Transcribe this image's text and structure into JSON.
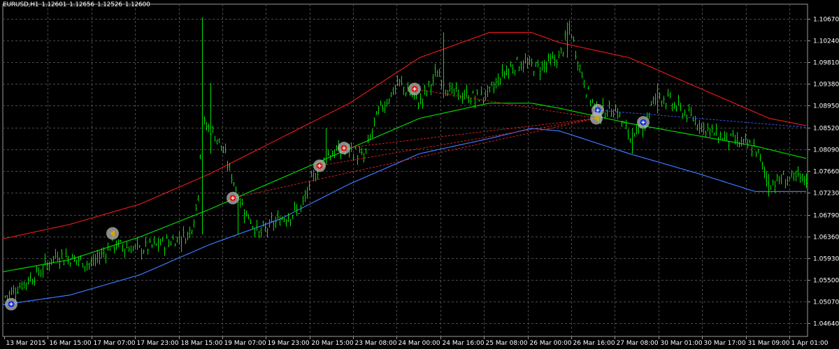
{
  "window": {
    "symbol_timeframe": "EURUSD,H1",
    "ohlc": [
      "1.12601",
      "1.12656",
      "1.12526",
      "1.12600"
    ]
  },
  "colors": {
    "background": "#000000",
    "grid": "#4a4a4a",
    "candles": "#00e000",
    "upper_band": "#e01818",
    "middle_band": "#00d800",
    "lower_band": "#3c78ff",
    "dotted_line": "#cc2020",
    "dotted_blue": "#3050e0",
    "axis_text": "#ffffff"
  },
  "chart_data": {
    "type": "candlestick",
    "ylim": [
      1.0438,
      1.1096
    ],
    "y_ticks": [
      "1.10670",
      "1.10240",
      "1.09810",
      "1.09380",
      "1.08950",
      "1.08520",
      "1.08090",
      "1.07660",
      "1.07230",
      "1.06790",
      "1.06360",
      "1.05930",
      "1.05500",
      "1.05070",
      "1.04640"
    ],
    "x_ticks": [
      "13 Mar 2015",
      "16 Mar 15:00",
      "17 Mar 07:00",
      "17 Mar 23:00",
      "18 Mar 15:00",
      "19 Mar 07:00",
      "19 Mar 23:00",
      "20 Mar 15:00",
      "23 Mar 08:00",
      "24 Mar 00:00",
      "24 Mar 16:00",
      "25 Mar 08:00",
      "26 Mar 00:00",
      "26 Mar 16:00",
      "27 Mar 08:00",
      "30 Mar 01:00",
      "30 Mar 17:00",
      "31 Mar 09:00",
      "1 Apr 01:00"
    ],
    "price_anchors": [
      [
        0,
        1.051
      ],
      [
        30,
        1.054
      ],
      [
        60,
        1.057
      ],
      [
        80,
        1.06
      ],
      [
        110,
        1.059
      ],
      [
        130,
        1.058
      ],
      [
        160,
        1.062
      ],
      [
        200,
        1.061
      ],
      [
        240,
        1.0625
      ],
      [
        270,
        1.064
      ],
      [
        282,
        1.07
      ],
      [
        288,
        1.086
      ],
      [
        300,
        1.085
      ],
      [
        315,
        1.082
      ],
      [
        330,
        1.076
      ],
      [
        345,
        1.07
      ],
      [
        370,
        1.064
      ],
      [
        400,
        1.067
      ],
      [
        430,
        1.069
      ],
      [
        450,
        1.076
      ],
      [
        470,
        1.08
      ],
      [
        500,
        1.081
      ],
      [
        520,
        1.079
      ],
      [
        540,
        1.088
      ],
      [
        570,
        1.094
      ],
      [
        600,
        1.09
      ],
      [
        625,
        1.096
      ],
      [
        645,
        1.092
      ],
      [
        680,
        1.091
      ],
      [
        700,
        1.092
      ],
      [
        720,
        1.096
      ],
      [
        740,
        1.098
      ],
      [
        770,
        1.097
      ],
      [
        800,
        1.099
      ],
      [
        815,
        1.105
      ],
      [
        825,
        1.099
      ],
      [
        840,
        1.092
      ],
      [
        855,
        1.088
      ],
      [
        880,
        1.089
      ],
      [
        905,
        1.082
      ],
      [
        920,
        1.086
      ],
      [
        940,
        1.092
      ],
      [
        960,
        1.09
      ],
      [
        990,
        1.087
      ],
      [
        1020,
        1.084
      ],
      [
        1060,
        1.082
      ],
      [
        1080,
        1.081
      ],
      [
        1100,
        1.074
      ],
      [
        1120,
        1.075
      ],
      [
        1155,
        1.075
      ]
    ],
    "spikes": [
      {
        "at": 288,
        "high": 1.107,
        "low": 1.064
      },
      {
        "at": 300,
        "high": 1.094,
        "low": 1.08
      },
      {
        "at": 340,
        "high": 1.072,
        "low": 1.064
      },
      {
        "at": 465,
        "high": 1.085,
        "low": 1.078
      },
      {
        "at": 635,
        "high": 1.104,
        "low": 1.091
      },
      {
        "at": 812,
        "high": 1.106,
        "low": 1.099
      },
      {
        "at": 905,
        "high": 1.085,
        "low": 1.08
      },
      {
        "at": 940,
        "high": 1.094,
        "low": 1.088
      },
      {
        "at": 1100,
        "high": 1.076,
        "low": 1.0715
      }
    ],
    "series": [
      {
        "key": "upper",
        "anchors": [
          [
            0,
            1.063
          ],
          [
            100,
            1.066
          ],
          [
            200,
            1.07
          ],
          [
            300,
            1.076
          ],
          [
            400,
            1.083
          ],
          [
            500,
            1.09
          ],
          [
            600,
            1.099
          ],
          [
            700,
            1.104
          ],
          [
            760,
            1.104
          ],
          [
            800,
            1.102
          ],
          [
            900,
            1.099
          ],
          [
            1000,
            1.093
          ],
          [
            1100,
            1.087
          ],
          [
            1155,
            1.0855
          ]
        ]
      },
      {
        "key": "middle",
        "anchors": [
          [
            0,
            1.0565
          ],
          [
            100,
            1.059
          ],
          [
            200,
            1.0635
          ],
          [
            300,
            1.069
          ],
          [
            400,
            1.075
          ],
          [
            500,
            1.081
          ],
          [
            600,
            1.087
          ],
          [
            700,
            1.09
          ],
          [
            760,
            1.09
          ],
          [
            800,
            1.089
          ],
          [
            900,
            1.086
          ],
          [
            1000,
            1.0835
          ],
          [
            1080,
            1.0815
          ],
          [
            1155,
            1.079
          ]
        ]
      },
      {
        "key": "lower",
        "anchors": [
          [
            0,
            1.05
          ],
          [
            100,
            1.052
          ],
          [
            200,
            1.056
          ],
          [
            300,
            1.062
          ],
          [
            400,
            1.067
          ],
          [
            500,
            1.074
          ],
          [
            600,
            1.08
          ],
          [
            700,
            1.083
          ],
          [
            760,
            1.085
          ],
          [
            800,
            1.0845
          ],
          [
            900,
            1.08
          ],
          [
            1000,
            1.076
          ],
          [
            1080,
            1.0725
          ],
          [
            1155,
            1.0725
          ]
        ]
      }
    ],
    "markers": [
      {
        "x": 16,
        "price": 1.0502,
        "kind": "buy"
      },
      {
        "x": 161,
        "price": 1.0642,
        "kind": "flag"
      },
      {
        "x": 333,
        "price": 1.0712,
        "kind": "sell"
      },
      {
        "x": 457,
        "price": 1.0776,
        "kind": "sell"
      },
      {
        "x": 492,
        "price": 1.0811,
        "kind": "sell"
      },
      {
        "x": 593,
        "price": 1.0928,
        "kind": "sell"
      },
      {
        "x": 855,
        "price": 1.0886,
        "kind": "buy"
      },
      {
        "x": 853,
        "price": 1.087,
        "kind": "flag"
      },
      {
        "x": 920,
        "price": 1.0862,
        "kind": "buy"
      }
    ],
    "dotted_links": [
      {
        "from": [
          593,
          1.0928
        ],
        "to": [
          853,
          1.087
        ],
        "color": "red"
      },
      {
        "from": [
          492,
          1.0811
        ],
        "to": [
          853,
          1.087
        ],
        "color": "red"
      },
      {
        "from": [
          457,
          1.0776
        ],
        "to": [
          853,
          1.087
        ],
        "color": "red"
      },
      {
        "from": [
          333,
          1.0712
        ],
        "to": [
          853,
          1.087
        ],
        "color": "red"
      },
      {
        "from": [
          855,
          1.0886
        ],
        "to": [
          1155,
          1.0852
        ],
        "color": "blue"
      }
    ]
  }
}
